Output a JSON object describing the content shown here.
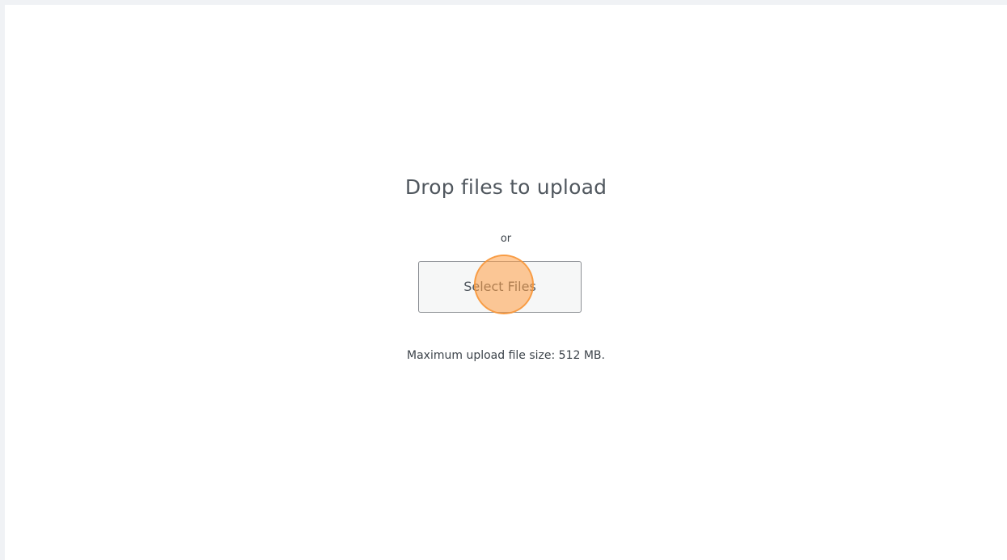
{
  "uploader": {
    "drop_title": "Drop files to upload",
    "or_text": "or",
    "select_button_label": "Select Files",
    "max_size_text": "Maximum upload file size: 512 MB."
  },
  "colors": {
    "page_background": "#f0f2f5",
    "panel_background": "#ffffff",
    "button_background": "#f6f7f7",
    "button_border": "#8c8f94",
    "click_indicator": "#ff9e46"
  }
}
